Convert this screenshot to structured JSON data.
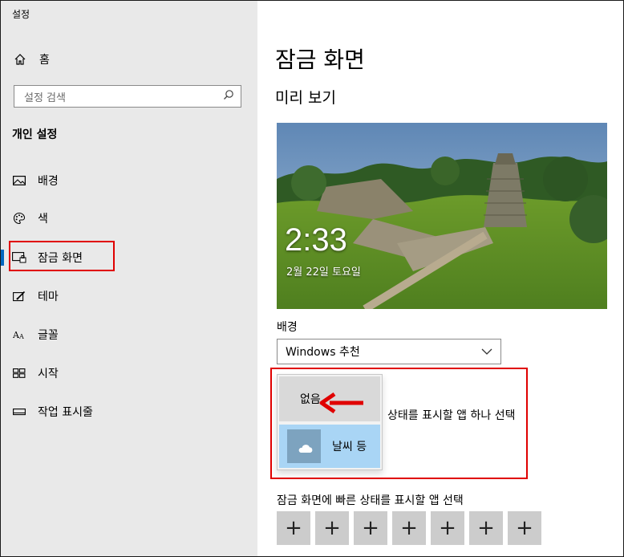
{
  "app": {
    "title": "설정"
  },
  "sidebar": {
    "home": {
      "label": "홈",
      "icon": "home-icon"
    },
    "search": {
      "placeholder": "설정 검색",
      "icon": "search-icon"
    },
    "section_title": "개인 설정",
    "items": [
      {
        "label": "배경",
        "icon": "picture-icon",
        "active": false
      },
      {
        "label": "색",
        "icon": "palette-icon",
        "active": false
      },
      {
        "label": "잠금 화면",
        "icon": "lock-screen-icon",
        "active": true
      },
      {
        "label": "테마",
        "icon": "theme-icon",
        "active": false
      },
      {
        "label": "글꼴",
        "icon": "font-icon",
        "active": false
      },
      {
        "label": "시작",
        "icon": "start-icon",
        "active": false
      },
      {
        "label": "작업 표시줄",
        "icon": "taskbar-icon",
        "active": false
      }
    ]
  },
  "main": {
    "title": "잠금 화면",
    "preview_title": "미리 보기",
    "preview": {
      "time": "2:33",
      "date": "2월 22일 토요일"
    },
    "background_label": "배경",
    "background_value": "Windows 추천",
    "detail_text_partial": "상태를 표시할 앱 하나 선택",
    "popup_options": [
      {
        "label": "없음"
      },
      {
        "label": "날씨 등",
        "icon": "weather-icon"
      }
    ],
    "quick_status_label": "잠금 화면에 빠른 상태를 표시할 앱 선택",
    "quick_status_slots": [
      "+",
      "+",
      "+",
      "+",
      "+",
      "+",
      "+"
    ]
  },
  "colors": {
    "highlight": "#e00000",
    "accent": "#0067c0",
    "selected_option": "#a9d5f5"
  }
}
